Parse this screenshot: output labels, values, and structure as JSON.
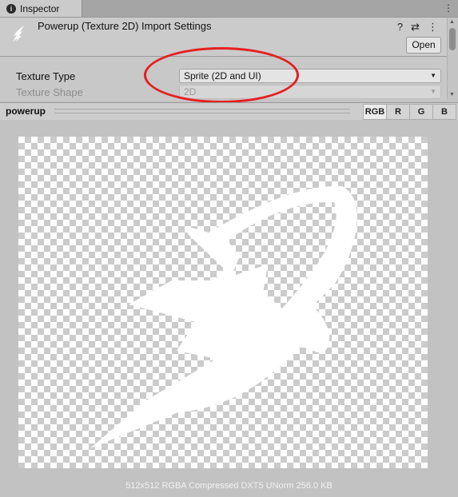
{
  "tab": {
    "label": "Inspector",
    "menu_icons": [
      "kebab-menu-icon"
    ]
  },
  "header": {
    "title": "Powerup (Texture 2D) Import Settings",
    "open_label": "Open",
    "icons": [
      "help-icon",
      "preset-icon",
      "kebab-menu-icon"
    ]
  },
  "settings": {
    "texture_type": {
      "label": "Texture Type",
      "value": "Sprite (2D and UI)"
    },
    "texture_shape": {
      "label": "Texture Shape",
      "value": "2D"
    }
  },
  "preview": {
    "title": "powerup",
    "channels": [
      {
        "label": "RGB",
        "active": true
      },
      {
        "label": "R",
        "active": false
      },
      {
        "label": "G",
        "active": false
      },
      {
        "label": "B",
        "active": false
      }
    ],
    "info": "512x512  RGBA Compressed DXT5 UNorm  256.0 KB"
  },
  "colors": {
    "highlight_circle": "#e5201f",
    "sprite": "#ffffff"
  }
}
